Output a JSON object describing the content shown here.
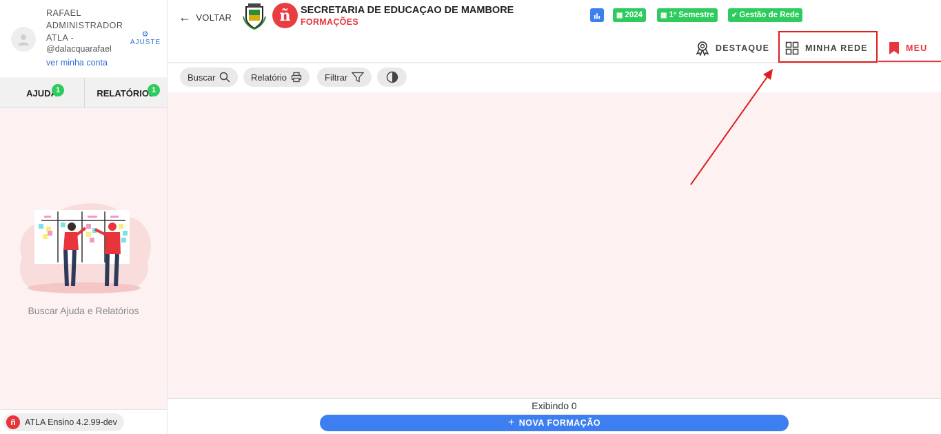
{
  "user": {
    "name": "RAFAEL ADMINISTRADOR ATLA -",
    "handle": "@dalacquarafael",
    "account_link": "ver minha conta",
    "adjust_label": "AJUSTE"
  },
  "side_tabs": [
    {
      "label": "AJUDA",
      "badge": "1"
    },
    {
      "label": "RELATÓRIOS",
      "badge": "1"
    }
  ],
  "sidebar_empty_text": "Buscar Ajuda e Relatórios",
  "version_label": "ATLA Ensino 4.2.99-dev",
  "header": {
    "back_label": "VOLTAR",
    "org_title": "SECRETARIA DE EDUCAÇAO DE MAMBORE",
    "module_title": "FORMAÇÕES",
    "chips": [
      {
        "label": "",
        "icon": "bar-chart-icon",
        "color": "#3d7ff0"
      },
      {
        "label": "2024",
        "icon": "calendar-icon",
        "color": "#2ecc5e"
      },
      {
        "label": "1º Semestre",
        "icon": "calendar-icon",
        "color": "#2ecc5e"
      },
      {
        "label": "Gestão de Rede",
        "icon": "check-circle-icon",
        "color": "#2ecc5e"
      }
    ],
    "tabs": {
      "highlight": "DESTAQUE",
      "network": "MINHA REDE",
      "mine": "MEU"
    }
  },
  "toolbar": {
    "search": "Buscar",
    "report": "Relatório",
    "filter": "Filtrar"
  },
  "footer": {
    "count_text": "Exibindo 0",
    "new_button": "NOVA FORMAÇÃO"
  },
  "colors": {
    "brand_red": "#e8353b",
    "accent_blue": "#3d7ff0",
    "badge_green": "#2ecc5e",
    "annotation_red": "#e01c1c"
  }
}
